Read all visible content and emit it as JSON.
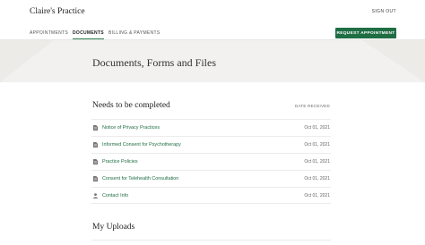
{
  "header": {
    "brand": "Claire's Practice",
    "sign_out": "SIGN OUT"
  },
  "nav": {
    "tabs": [
      {
        "label": "APPOINTMENTS"
      },
      {
        "label": "DOCUMENTS",
        "active": true
      },
      {
        "label": "BILLING & PAYMENTS"
      }
    ],
    "request_button": "REQUEST APPOINTMENT"
  },
  "hero": {
    "title": "Documents, Forms and Files"
  },
  "needs": {
    "title": "Needs to be completed",
    "date_header": "DATE RECEIVED",
    "items": [
      {
        "label": "Notice of Privacy Practices",
        "date": "Oct 01, 2021",
        "icon": "document-icon"
      },
      {
        "label": "Informed Consent for Psychotherapy",
        "date": "Oct 01, 2021",
        "icon": "document-icon"
      },
      {
        "label": "Practice Policies",
        "date": "Oct 01, 2021",
        "icon": "document-icon"
      },
      {
        "label": "Consent for Telehealth Consultation",
        "date": "Oct 01, 2021",
        "icon": "document-icon"
      },
      {
        "label": "Contact Info",
        "date": "Oct 01, 2021",
        "icon": "person-icon"
      }
    ]
  },
  "uploads": {
    "title": "My Uploads"
  },
  "colors": {
    "accent": "#1f6e43",
    "hero_bg": "#f2f1ef"
  }
}
